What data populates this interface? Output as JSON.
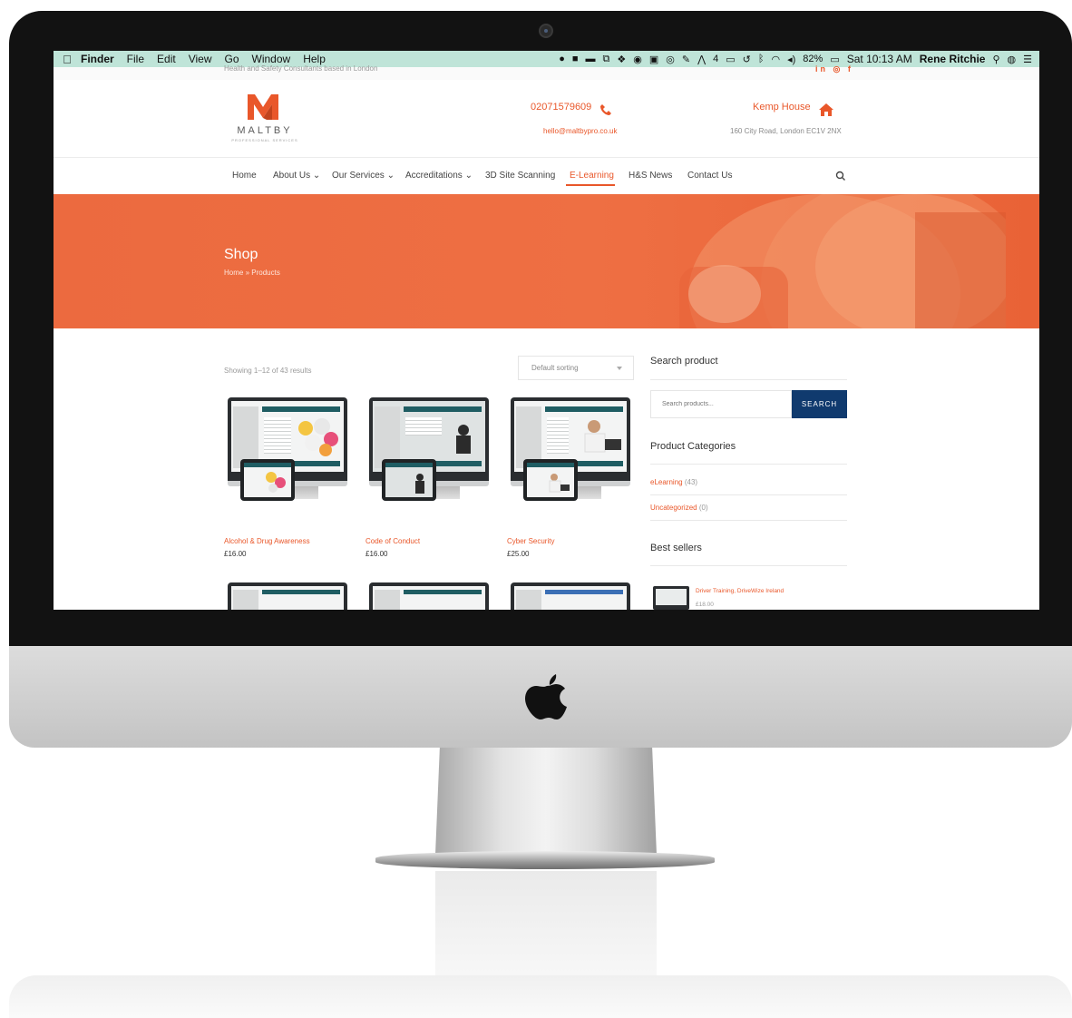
{
  "menubar": {
    "items": [
      "Finder",
      "File",
      "Edit",
      "View",
      "Go",
      "Window",
      "Help"
    ],
    "battery": "82%",
    "clock": "Sat 10:13 AM",
    "user": "Rene Ritchie",
    "airplay_count": "4"
  },
  "topbar": {
    "tagline": "Health and Safety Consultants based in London",
    "social": "in ◎ f"
  },
  "header": {
    "logo_name": "MALTBY",
    "logo_sub": "PROFESSIONAL SERVICES",
    "phone": "02071579609",
    "email": "hello@maltbypro.co.uk",
    "house": "Kemp House",
    "address": "160 City Road, London EC1V 2NX"
  },
  "nav": {
    "home": "Home",
    "about": "About Us",
    "services": "Our Services",
    "accreditations": "Accreditations",
    "scanning": "3D Site Scanning",
    "elearning": "E-Learning",
    "news": "H&S News",
    "contact": "Contact Us"
  },
  "hero": {
    "title": "Shop",
    "crumb_home": "Home",
    "crumb_sep": "»",
    "crumb_current": "Products"
  },
  "shop": {
    "results": "Showing 1–12 of 43 results",
    "sort": "Default sorting",
    "products": [
      {
        "name": "Alcohol & Drug Awareness",
        "price": "£16.00"
      },
      {
        "name": "Code of Conduct",
        "price": "£16.00"
      },
      {
        "name": "Cyber Security",
        "price": "£25.00"
      }
    ]
  },
  "sidebar": {
    "search_title": "Search product",
    "search_placeholder": "Search products...",
    "search_button": "SEARCH",
    "categories_title": "Product Categories",
    "categories": [
      {
        "name": "eLearning",
        "count": "(43)"
      },
      {
        "name": "Uncategorized",
        "count": "(0)"
      }
    ],
    "bestsellers_title": "Best sellers",
    "bestseller": {
      "name": "Driver Training, DriveWize Ireland",
      "price": "£18.00"
    }
  },
  "colors": {
    "accent": "#e9572a",
    "button": "#103a6e",
    "menubar": "#bfe4d8"
  }
}
